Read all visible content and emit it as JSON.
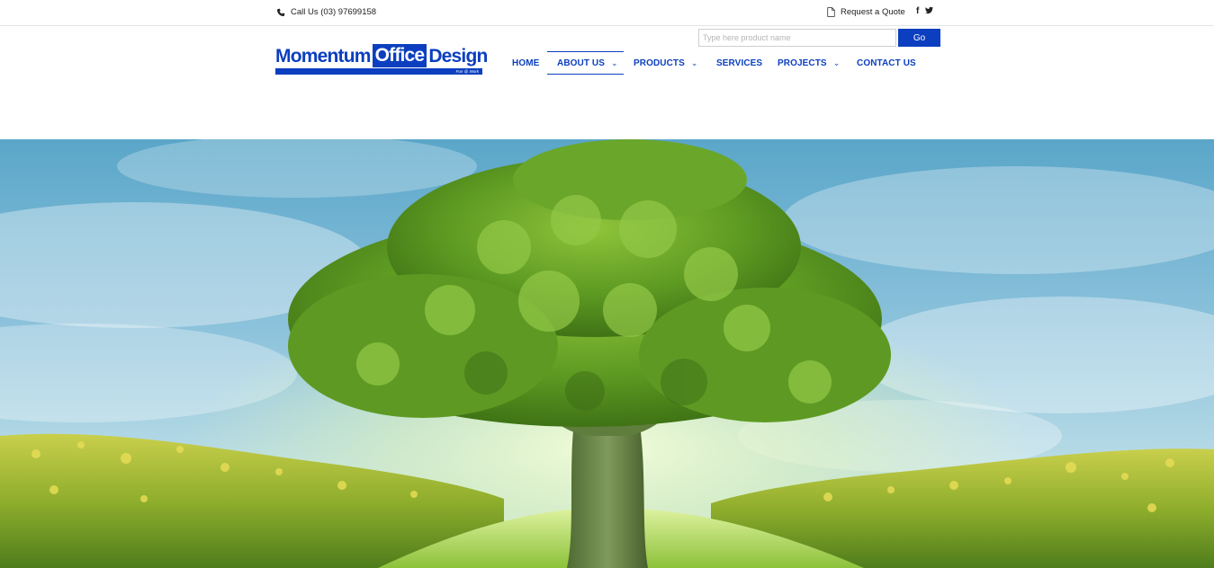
{
  "topbar": {
    "phone_text": "Call Us (03) 97699158",
    "quote_text": "Request a Quote",
    "social": {
      "facebook": "f",
      "twitter": "t"
    }
  },
  "logo": {
    "word1": "Momentum",
    "word2": "Office",
    "word3": "Design",
    "tagline": "Fun @ Work"
  },
  "search": {
    "placeholder": "Type here product name",
    "button_label": "Go"
  },
  "nav": {
    "items": [
      {
        "label": "HOME",
        "has_dropdown": false,
        "active": false
      },
      {
        "label": "ABOUT US",
        "has_dropdown": true,
        "active": true
      },
      {
        "label": "PRODUCTS",
        "has_dropdown": true,
        "active": false
      },
      {
        "label": "SERVICES",
        "has_dropdown": false,
        "active": false
      },
      {
        "label": "PROJECTS",
        "has_dropdown": true,
        "active": false
      },
      {
        "label": "CONTACT US",
        "has_dropdown": false,
        "active": false
      }
    ],
    "dropdown_glyph": "⌄"
  },
  "colors": {
    "brand_blue": "#0b3fbf",
    "sky": "#6fb0d6",
    "foliage": "#6aa62a",
    "field": "#b8c43a"
  },
  "icons": {
    "phone": "phone-icon",
    "quote": "document-icon",
    "facebook": "facebook-icon",
    "twitter": "twitter-icon",
    "dropdown": "chevron-down-icon"
  },
  "hero": {
    "image": "tree-in-field-hero-image"
  }
}
